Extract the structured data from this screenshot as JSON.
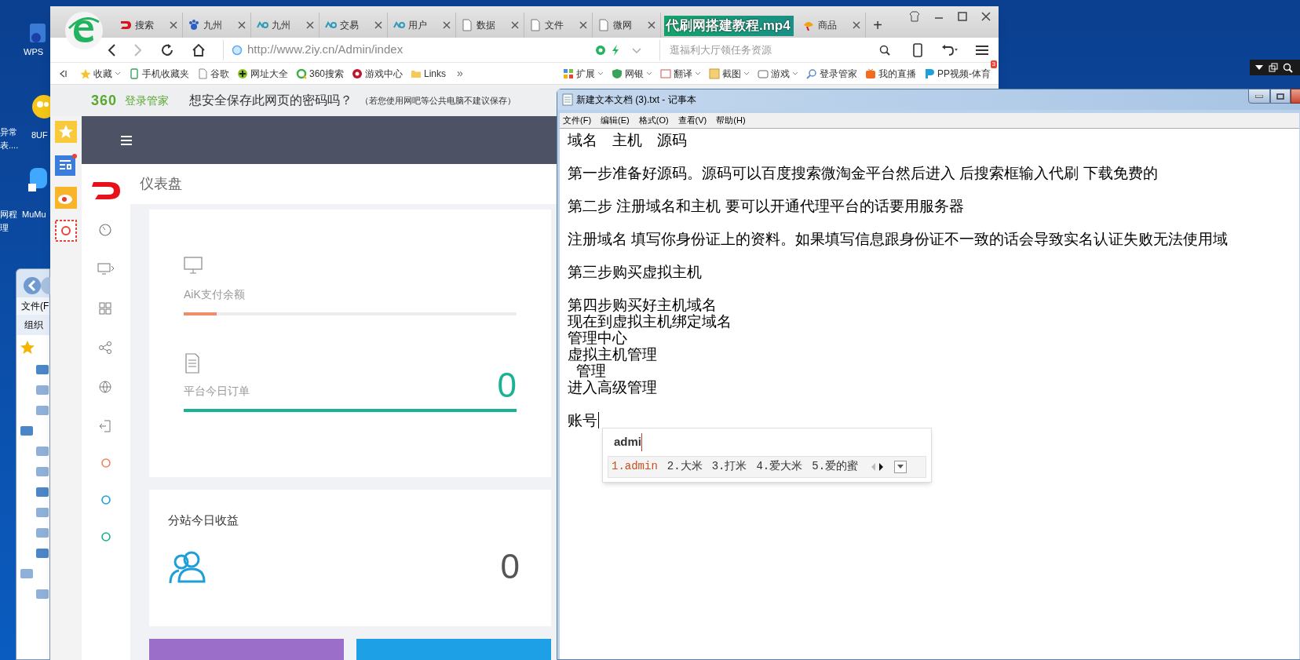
{
  "desktop": {
    "icons": [
      {
        "label": "WPS"
      },
      {
        "label": "8UF"
      },
      {
        "label": "异常"
      },
      {
        "label": "表...."
      },
      {
        "label": "MuMu"
      },
      {
        "label": "网程"
      },
      {
        "label": "理"
      }
    ],
    "explorer": {
      "menu": "文件(F",
      "toolbar": "组织"
    }
  },
  "video_title": "代刷网搭建教程.mp4",
  "browser": {
    "tabs": [
      {
        "label": "搜索"
      },
      {
        "label": "九州"
      },
      {
        "label": "九州"
      },
      {
        "label": "交易"
      },
      {
        "label": "用户"
      },
      {
        "label": "数据"
      },
      {
        "label": "文件"
      },
      {
        "label": "微网"
      },
      {
        "label": "商品"
      }
    ],
    "new_tab": "+",
    "address": "http://www.2iy.cn/Admin/index",
    "search_placeholder": "逛福利大厅领任务资源",
    "bookmarks_left": [
      "收藏",
      "手机收藏夹",
      "谷歌",
      "网址大全",
      "360搜索",
      "游戏中心",
      "Links"
    ],
    "bookmarks_more": "»",
    "bookmarks_right": [
      "扩展",
      "网银",
      "翻译",
      "截图",
      "游戏",
      "登录管家",
      "我的直播",
      "PP视频-体育"
    ],
    "badge": "3",
    "password_bar": {
      "brand": "360",
      "product": "登录管家",
      "question": "想安全保存此网页的密码吗？",
      "note": "（若您使用网吧等公共电脑不建议保存）"
    }
  },
  "dashboard": {
    "page_title": "仪表盘",
    "nav_dots": [
      {
        "color": "#f0825f"
      },
      {
        "color": "#1e9fd8"
      },
      {
        "color": "#1aaf8b"
      }
    ],
    "stats": [
      {
        "label": "AiK支付余额",
        "level": 0.1,
        "color": "#f08c6e"
      },
      {
        "label": "平台今日订单",
        "value": "0",
        "level": 1.0,
        "color": "#19b394"
      }
    ],
    "revenue": {
      "label": "分站今日收益",
      "value": "0"
    },
    "tiles": [
      {
        "color": "#9b6fc9"
      },
      {
        "color": "#1ea0e6"
      }
    ]
  },
  "notepad": {
    "title": "新建文本文档 (3).txt - 记事本",
    "menu": [
      "文件(F)",
      "编辑(E)",
      "格式(O)",
      "查看(V)",
      "帮助(H)"
    ],
    "paragraphs": [
      [
        "域名　主机　源码"
      ],
      [
        "第一步准备好源码。源码可以百度搜索微淘金平台然后进入 后搜索框输入代刷 下载免费的"
      ],
      [
        "第二步 注册域名和主机 要可以开通代理平台的话要用服务器"
      ],
      [
        "注册域名 填写你身份证上的资料。如果填写信息跟身份证不一致的话会导致实名认证失败无法使用域"
      ],
      [
        "第三步购买虚拟主机"
      ],
      [
        "第四步购买好主机域名",
        "现在到虚拟主机绑定域名",
        "管理中心",
        "虚拟主机管理",
        "  管理",
        "进入高级管理"
      ],
      [
        "账号"
      ]
    ]
  },
  "ime": {
    "composition": "admi",
    "candidates": [
      {
        "label": "1.admin",
        "selected": true
      },
      {
        "label": "2.大米",
        "selected": false
      },
      {
        "label": "3.打米",
        "selected": false
      },
      {
        "label": "4.爱大米",
        "selected": false
      },
      {
        "label": "5.爱的蜜",
        "selected": false
      }
    ]
  }
}
